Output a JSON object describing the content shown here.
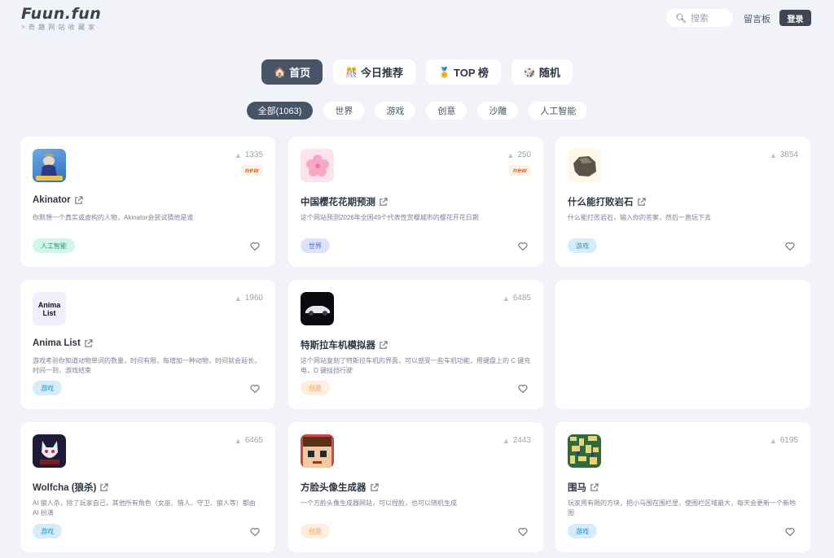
{
  "header": {
    "logo": "Fuun.fun",
    "logo_sub": "> 奇 趣 网 站 收 藏 家",
    "search_placeholder": "搜索",
    "guestbook": "留言板",
    "login": "登录"
  },
  "nav": {
    "tabs": [
      {
        "label": "首页",
        "icon": "🏠"
      },
      {
        "label": "今日推荐",
        "icon": "🎊"
      },
      {
        "label": "TOP 榜",
        "icon": "🏅"
      },
      {
        "label": "随机",
        "icon": "🎲"
      }
    ]
  },
  "categories": [
    "全部(1063)",
    "世界",
    "游戏",
    "创意",
    "沙雕",
    "人工智能"
  ],
  "new_label": "new",
  "cards": [
    {
      "title": "Akinator",
      "views": "1335",
      "desc": "你默想一个真实或虚构的人物，Akinator会尝试猜他是谁",
      "tag": "人工智能",
      "icon": "genie-icon"
    },
    {
      "title": "中国樱花花期预测",
      "views": "250",
      "desc": "这个网站预测2026年全国49个代表性赏樱城市的樱花开花日期",
      "tag": "世界",
      "icon": "cherry-blossom-icon"
    },
    {
      "title": "什么能打败岩石",
      "views": "3854",
      "desc": "什么能打败岩石，输入你的答案，然后一直玩下去",
      "tag": "游戏",
      "icon": "rock-icon"
    },
    {
      "title": "Anima List",
      "views": "1960",
      "desc": "游戏考验你知道动物单词的数量，时间有限，每增加一种动物，时间就会延长，时间一到，游戏结束",
      "tag": "游戏",
      "icon": "anima-list-icon",
      "icon_text": "Anima\nList"
    },
    {
      "title": "特斯拉车机模拟器",
      "views": "6485",
      "desc": "这个网站复刻了特斯拉车机的界面，可以感受一些车机功能，用键盘上的 C 键充电，D 键挂挡行驶",
      "tag": "创意",
      "icon": "tesla-car-icon"
    },
    {
      "title": "Wolfcha (狼杀)",
      "views": "6465",
      "desc": "AI 狼人杀，除了玩家自己，其他所有角色（女巫、猎人、守卫、狼人等）都由 AI 扮演",
      "tag": "游戏",
      "icon": "wolf-icon"
    },
    {
      "title": "方脸头像生成器",
      "views": "2443",
      "desc": "一个方脸头像生成器网站，可以捏脸，也可以随机生成",
      "tag": "创意",
      "icon": "square-face-icon"
    },
    {
      "title": "围马",
      "views": "6195",
      "desc": "玩家用有限的方块，把小马围在围栏里，使围栏区域最大，每天会更新一个新地图",
      "tag": "游戏",
      "icon": "maze-map-icon"
    }
  ],
  "colors": {
    "tag_ai": "#1f9d76",
    "tag_world": "#4f6dd8",
    "tag_game": "#2b8fd1",
    "tag_idea": "#e8a45d",
    "accent_dark": "#475467"
  }
}
